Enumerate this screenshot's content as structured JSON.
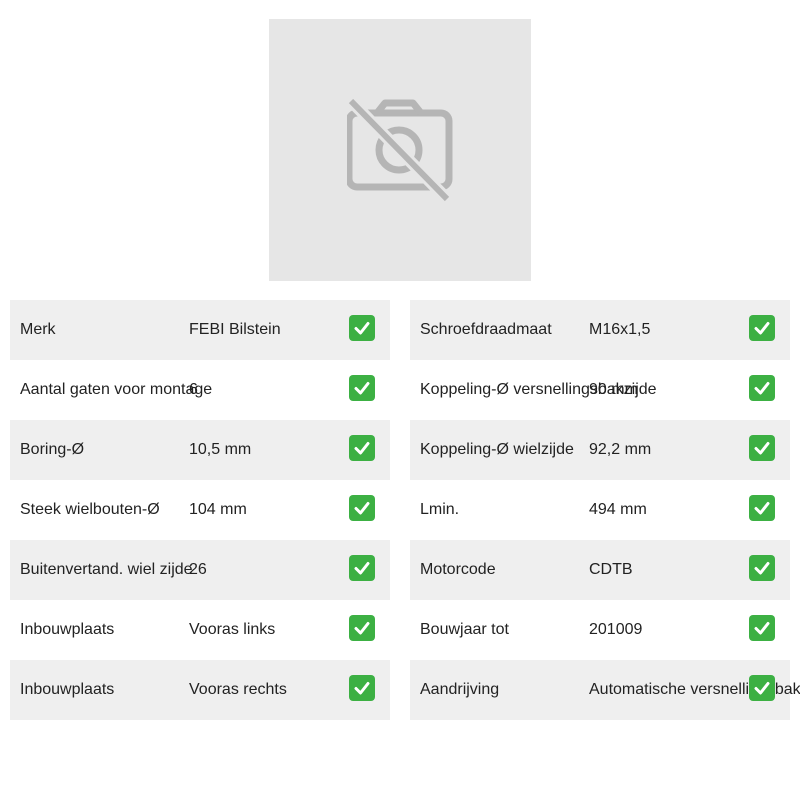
{
  "image_placeholder": {
    "icon": "camera-off-icon"
  },
  "check_color": "#3cb043",
  "left_table": [
    {
      "label": "Merk",
      "value": "FEBI Bilstein"
    },
    {
      "label": "Aantal gaten voor montage",
      "value": "6"
    },
    {
      "label": "Boring-Ø",
      "value": "10,5 mm"
    },
    {
      "label": "Steek wielbouten-Ø",
      "value": "104 mm"
    },
    {
      "label": "Buitenvertand. wiel zijde",
      "value": "26"
    },
    {
      "label": "Inbouwplaats",
      "value": "Vooras links"
    },
    {
      "label": "Inbouwplaats",
      "value": "Vooras rechts"
    }
  ],
  "right_table": [
    {
      "label": "Schroefdraadmaat",
      "value": "M16x1,5"
    },
    {
      "label": "Koppeling-Ø versnellingsbakzijde",
      "value": "90 mm"
    },
    {
      "label": "Koppeling-Ø wielzijde",
      "value": "92,2 mm"
    },
    {
      "label": "Lmin.",
      "value": "494 mm"
    },
    {
      "label": "Motorcode",
      "value": "CDTB"
    },
    {
      "label": "Bouwjaar tot",
      "value": "201009"
    },
    {
      "label": "Aandrijving",
      "value": "Automatische versnellingsbak"
    }
  ]
}
